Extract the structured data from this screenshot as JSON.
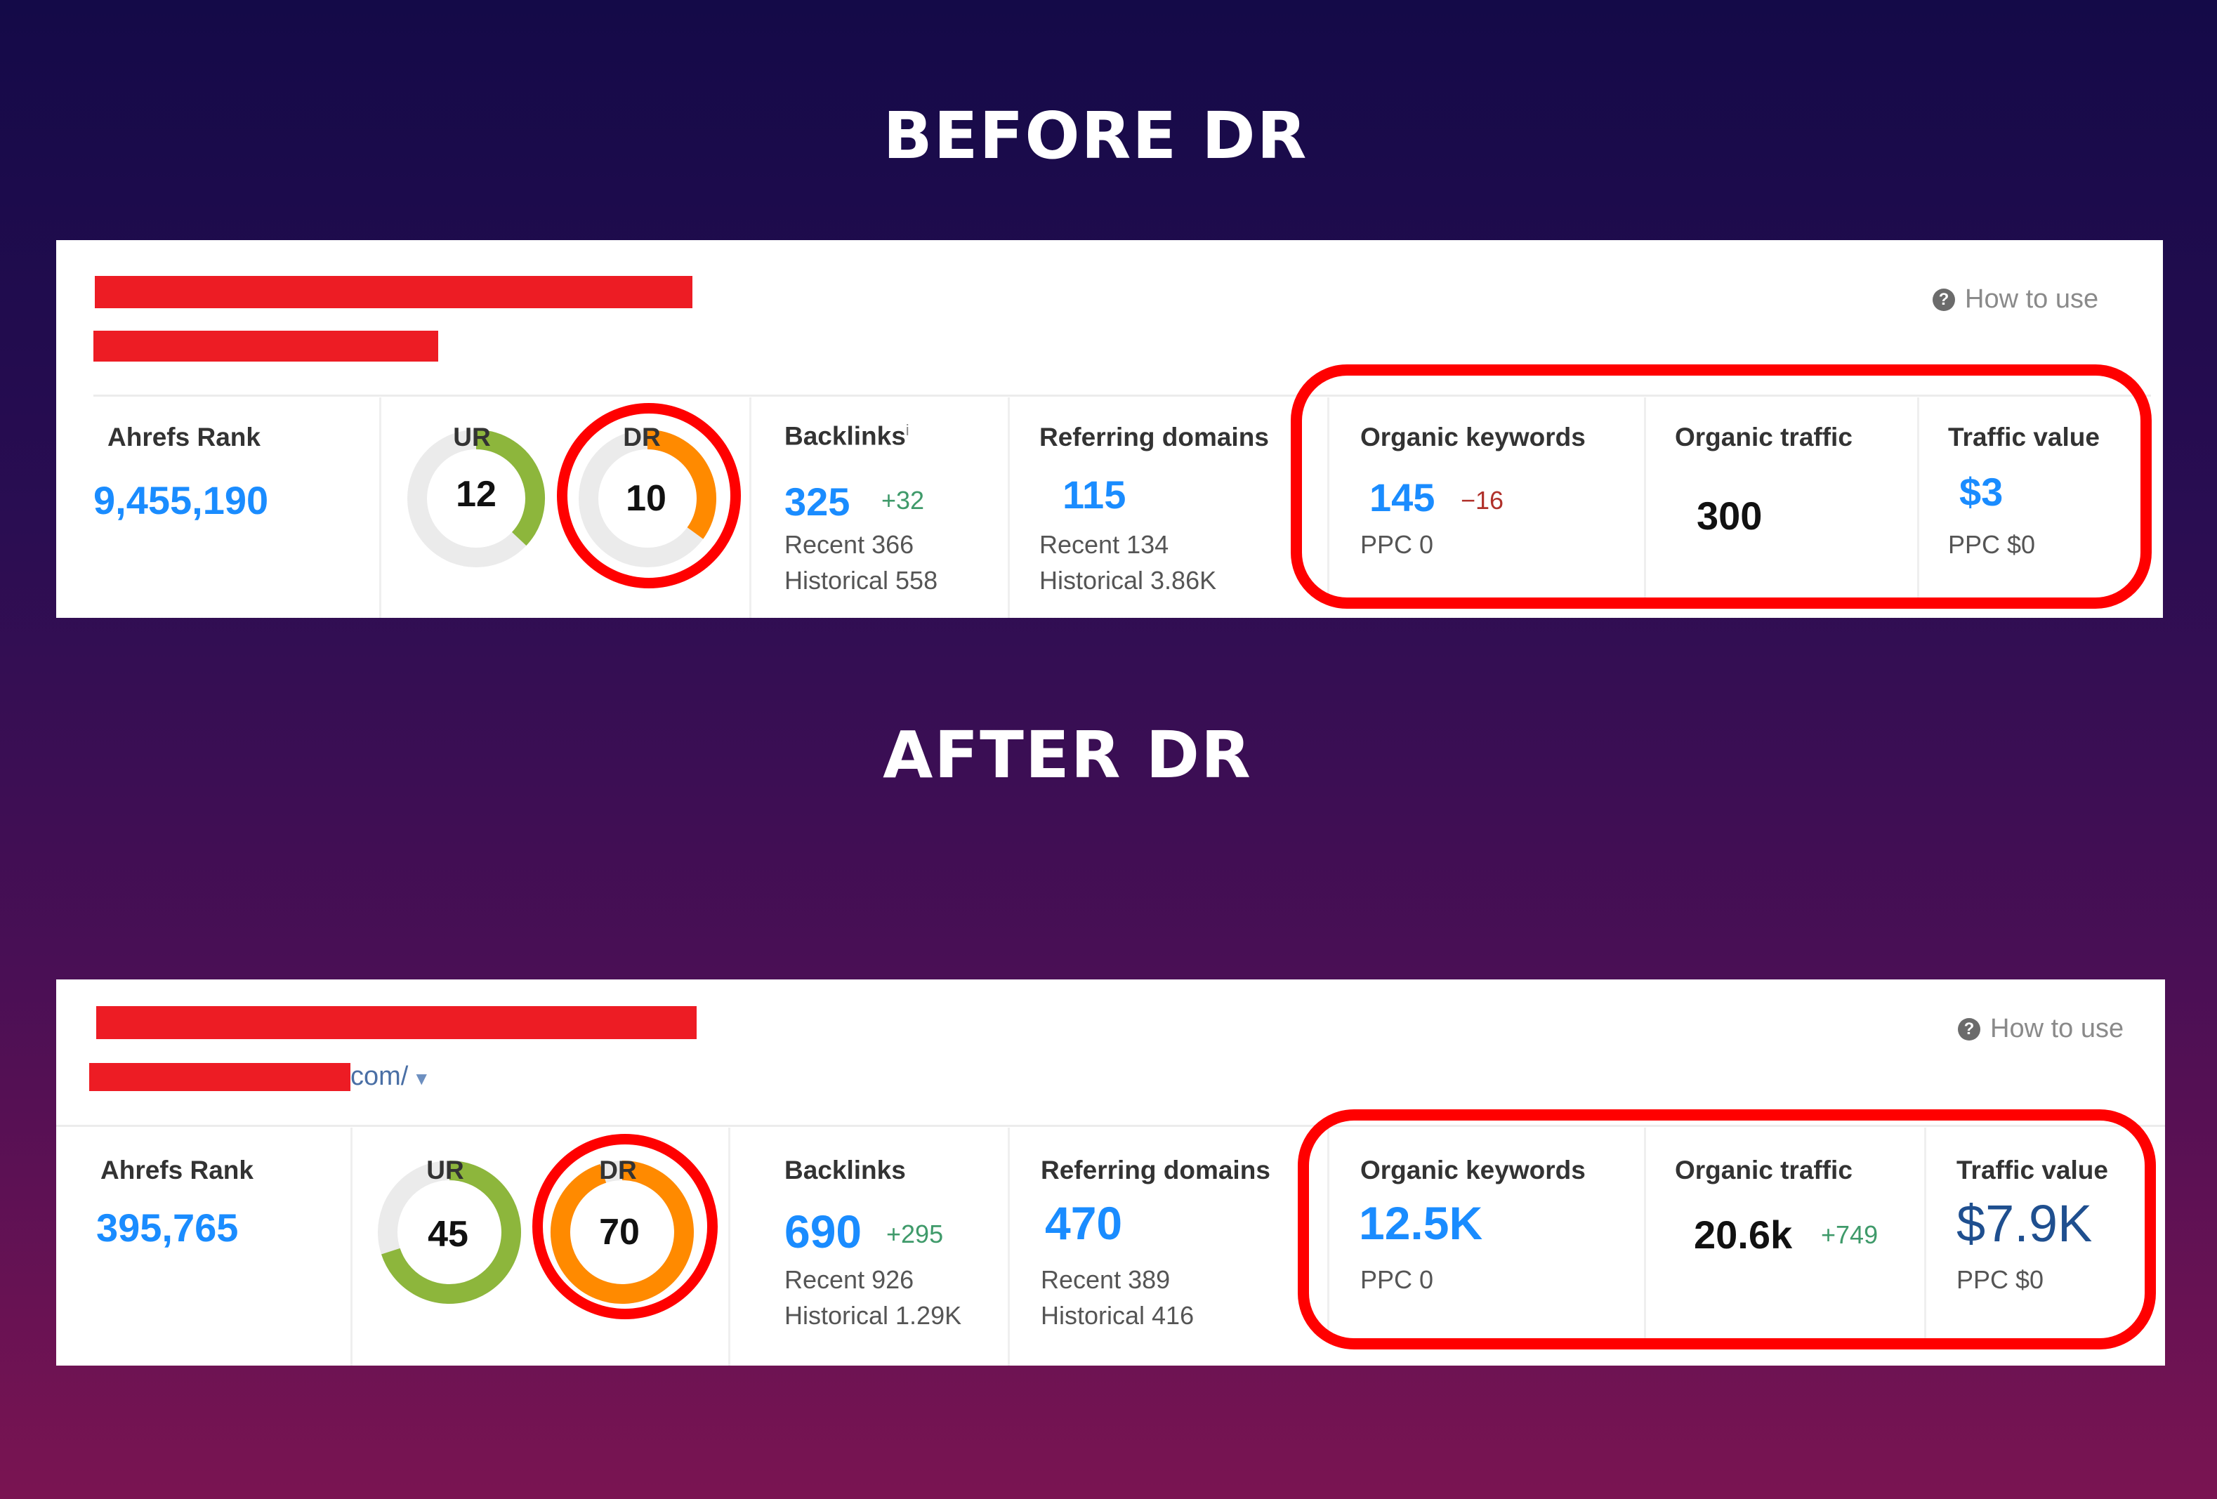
{
  "colors": {
    "accent_blue": "#1a8cff",
    "ur_green": "#8db63c",
    "dr_orange": "#ff8a00",
    "track": "#ebebeb",
    "highlight_red": "#ff0000",
    "redaction": "#ed1c24"
  },
  "before": {
    "heading": "BEFORE DR",
    "how_to_use": "How to use",
    "help_icon": "question-circle-icon",
    "ahrefs_rank": {
      "label": "Ahrefs Rank",
      "value": "9,455,190"
    },
    "ur": {
      "label": "UR",
      "value": 12
    },
    "dr": {
      "label": "DR",
      "value": 10
    },
    "backlinks": {
      "label": "Backlinks",
      "info": "i",
      "value": "325",
      "delta": "+32",
      "recent": "Recent 366",
      "historical": "Historical 558"
    },
    "referring_domains": {
      "label": "Referring domains",
      "value": "115",
      "recent": "Recent 134",
      "historical": "Historical 3.86K"
    },
    "organic_keywords": {
      "label": "Organic keywords",
      "value": "145",
      "delta": "−16",
      "ppc": "PPC 0"
    },
    "organic_traffic": {
      "label": "Organic traffic",
      "value": "300"
    },
    "traffic_value": {
      "label": "Traffic value",
      "value": "$3",
      "ppc": "PPC $0"
    }
  },
  "after": {
    "heading": "AFTER DR",
    "url_suffix": "com/",
    "url_dropdown_icon": "caret-down-icon",
    "how_to_use": "How to use",
    "help_icon": "question-circle-icon",
    "ahrefs_rank": {
      "label": "Ahrefs Rank",
      "value": "395,765"
    },
    "ur": {
      "label": "UR",
      "value": 45
    },
    "dr": {
      "label": "DR",
      "value": 70
    },
    "backlinks": {
      "label": "Backlinks",
      "value": "690",
      "delta": "+295",
      "recent": "Recent 926",
      "historical": "Historical 1.29K"
    },
    "referring_domains": {
      "label": "Referring domains",
      "value": "470",
      "recent": "Recent 389",
      "historical": "Historical 416"
    },
    "organic_keywords": {
      "label": "Organic keywords",
      "value": "12.5K",
      "ppc": "PPC 0"
    },
    "organic_traffic": {
      "label": "Organic traffic",
      "value": "20.6k",
      "delta": "+749"
    },
    "traffic_value": {
      "label": "Traffic value",
      "value": "$7.9K",
      "ppc": "PPC $0"
    }
  }
}
